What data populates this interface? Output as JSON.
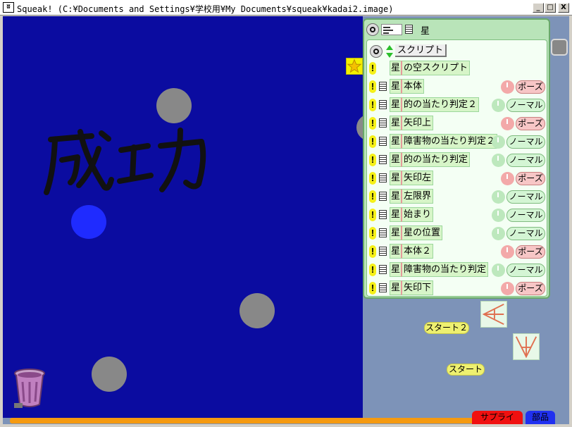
{
  "window": {
    "app_icon": "squeak-icon",
    "title": "Squeak! (C:¥Documents and Settings¥学校用¥My Documents¥squeak¥kadai2.image)",
    "min_label": "_",
    "max_label": "□",
    "close_label": "X"
  },
  "stage": {
    "background_color": "#0b0ca0",
    "handwriting_text": "成功"
  },
  "viewer": {
    "object_name": "星",
    "scripts_title": "スクリプト",
    "empty_script": {
      "object": "星",
      "name": "の空スクリプト"
    },
    "scripts": [
      {
        "object": "星",
        "name": "本体",
        "status": "ポーズ",
        "kind": "pause"
      },
      {
        "object": "星",
        "name": "的の当たり判定２",
        "status": "ノーマル",
        "kind": "normal"
      },
      {
        "object": "星",
        "name": "矢印上",
        "status": "ポーズ",
        "kind": "pause"
      },
      {
        "object": "星",
        "name": "障害物の当たり判定２",
        "status": "ノーマル",
        "kind": "normal"
      },
      {
        "object": "星",
        "name": "的の当たり判定",
        "status": "ノーマル",
        "kind": "normal"
      },
      {
        "object": "星",
        "name": "矢印左",
        "status": "ポーズ",
        "kind": "pause"
      },
      {
        "object": "星",
        "name": "左限界",
        "status": "ノーマル",
        "kind": "normal"
      },
      {
        "object": "星",
        "name": "始まり",
        "status": "ノーマル",
        "kind": "normal"
      },
      {
        "object": "星",
        "name": "星の位置",
        "status": "ノーマル",
        "kind": "normal"
      },
      {
        "object": "星",
        "name": "本体２",
        "status": "ポーズ",
        "kind": "pause"
      },
      {
        "object": "星",
        "name": "障害物の当たり判定",
        "status": "ノーマル",
        "kind": "normal"
      },
      {
        "object": "星",
        "name": "矢印下",
        "status": "ポーズ",
        "kind": "pause"
      }
    ]
  },
  "world_buttons": {
    "start2": "スタート２",
    "start": "スタート"
  },
  "flaps": {
    "supplies": "サプライ",
    "parts": "部品"
  },
  "colors": {
    "pause_clock": "#f3a9a9",
    "normal_clock": "#bde8bd"
  }
}
